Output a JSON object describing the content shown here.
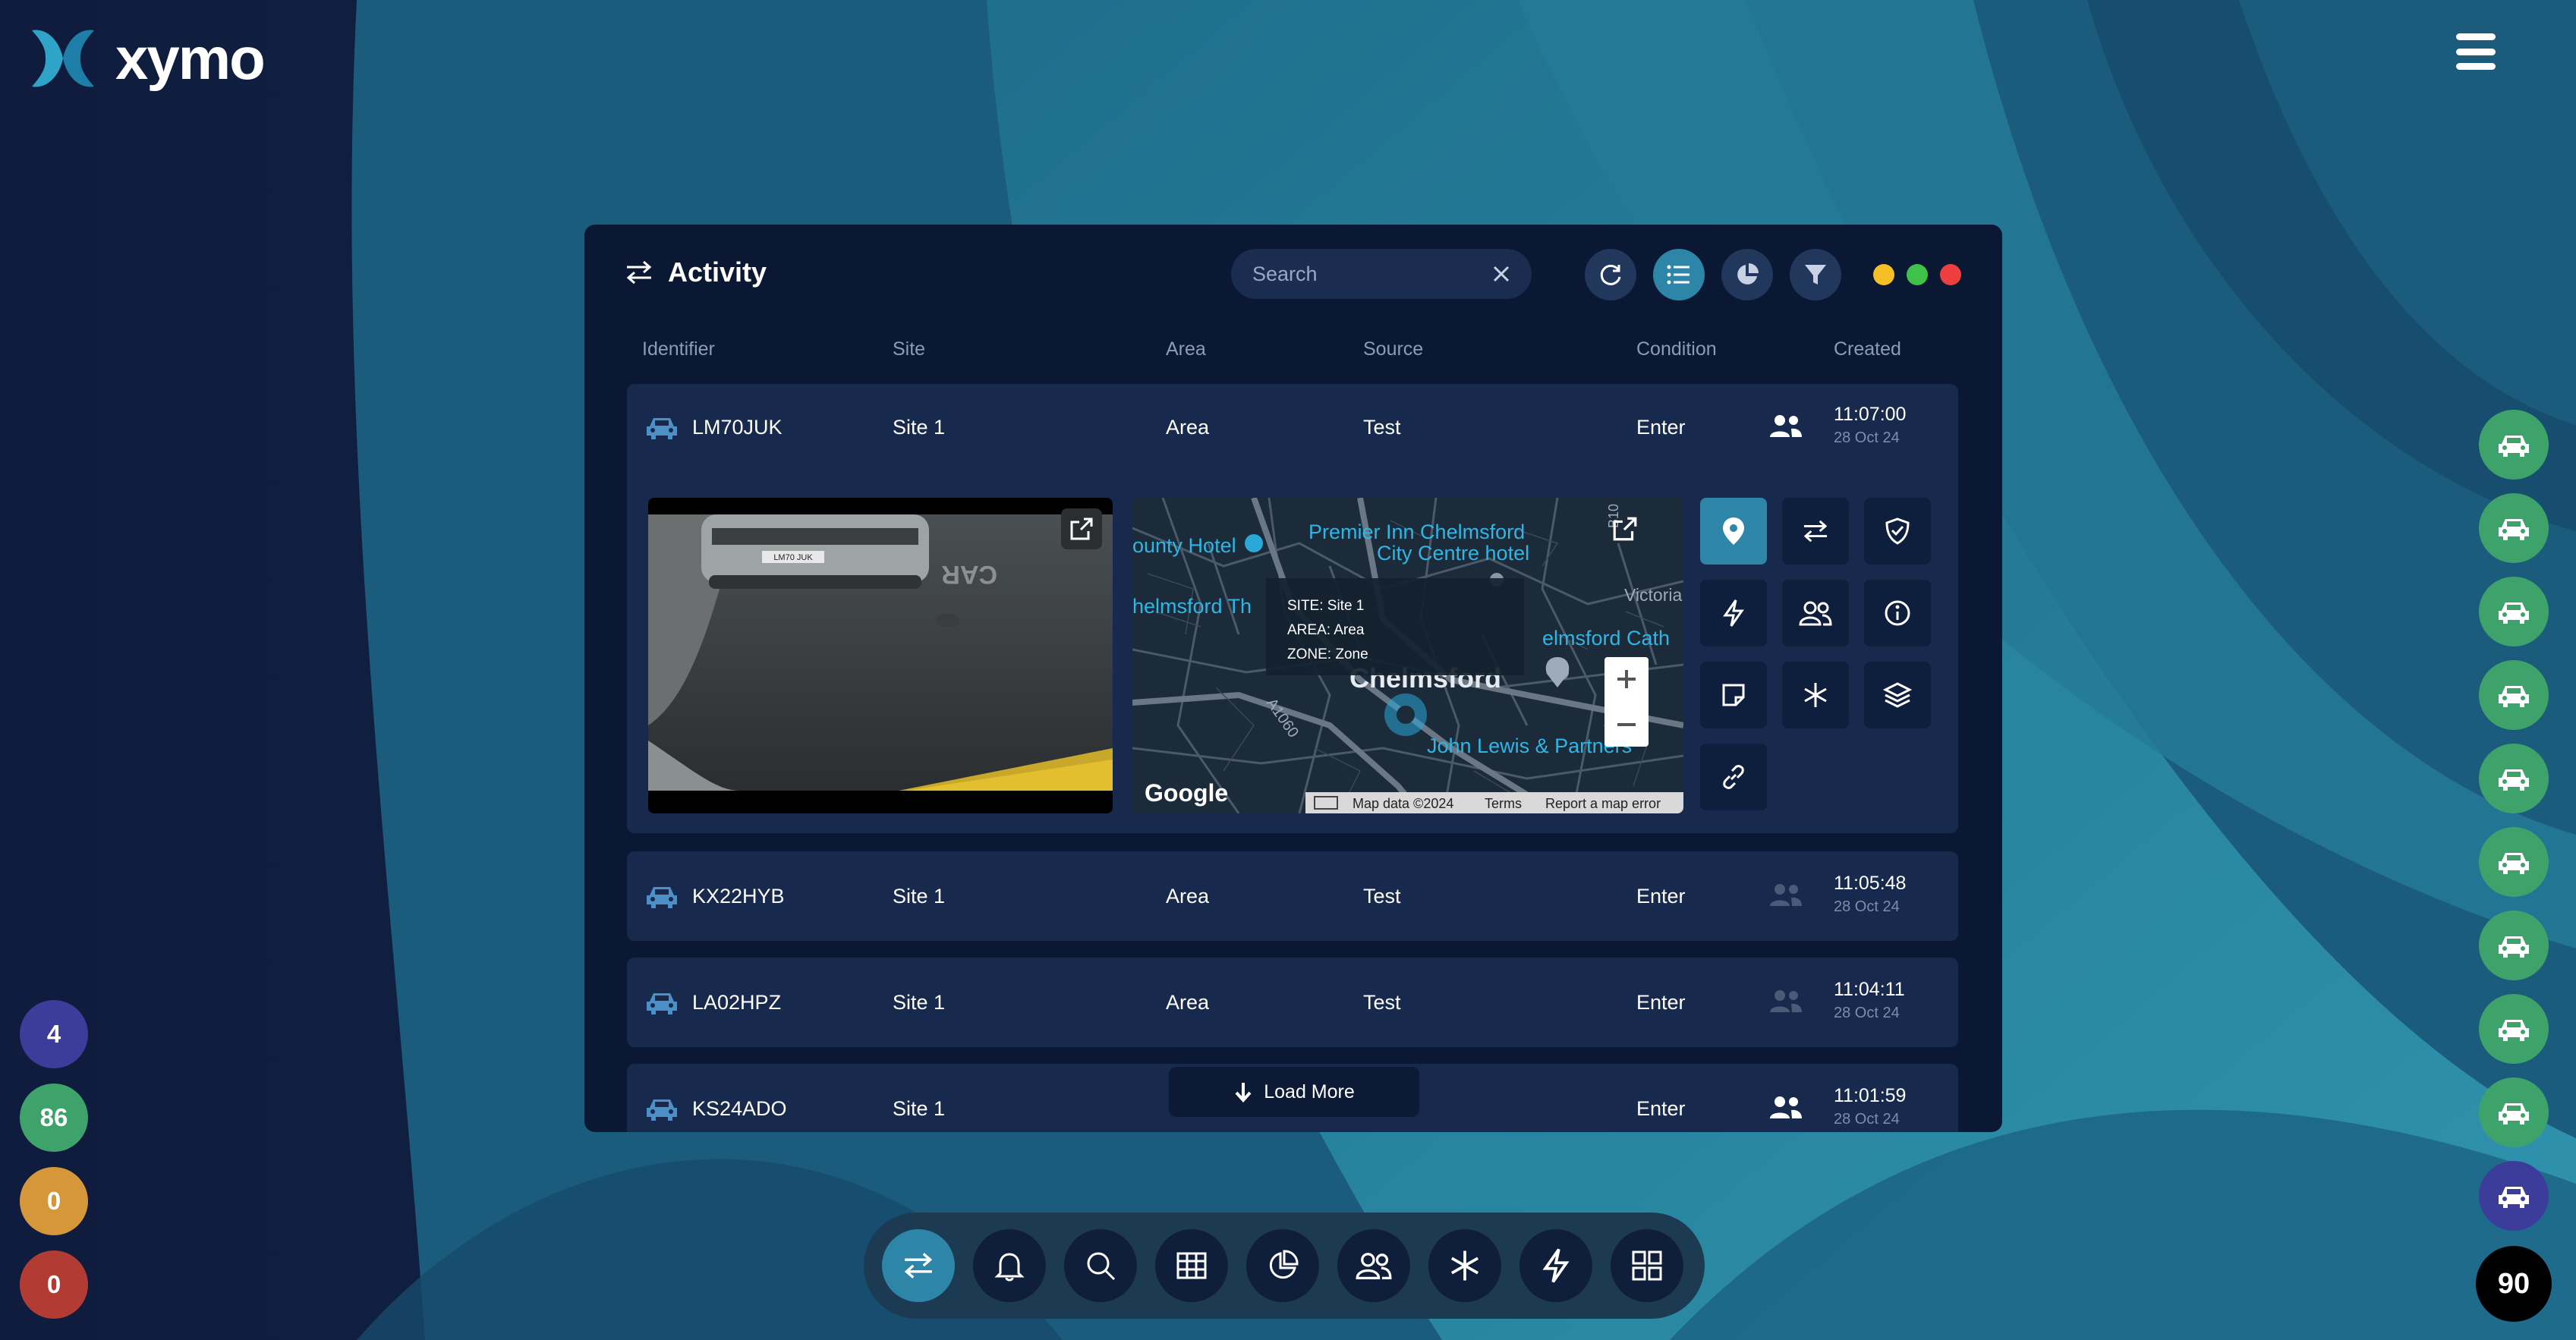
{
  "brand": {
    "name": "xymo"
  },
  "left_stats": [
    {
      "value": "4",
      "color": "#3c3c9a"
    },
    {
      "value": "86",
      "color": "#3ea36a"
    },
    {
      "value": "0",
      "color": "#d6973a"
    },
    {
      "value": "0",
      "color": "#b23b34"
    }
  ],
  "right_count": "90",
  "panel": {
    "title": "Activity",
    "search_placeholder": "Search",
    "window_dots": [
      "#f5c026",
      "#3ec24a",
      "#ee3f3f"
    ]
  },
  "columns": [
    "Identifier",
    "Site",
    "Area",
    "Source",
    "Condition",
    "Created"
  ],
  "rows": [
    {
      "identifier": "LM70JUK",
      "site": "Site 1",
      "area": "Area",
      "source": "Test",
      "condition": "Enter",
      "time": "11:07:00",
      "date": "28 Oct 24",
      "people_active": true
    },
    {
      "identifier": "KX22HYB",
      "site": "Site 1",
      "area": "Area",
      "source": "Test",
      "condition": "Enter",
      "time": "11:05:48",
      "date": "28 Oct 24",
      "people_active": false
    },
    {
      "identifier": "LA02HPZ",
      "site": "Site 1",
      "area": "Area",
      "source": "Test",
      "condition": "Enter",
      "time": "11:04:11",
      "date": "28 Oct 24",
      "people_active": false
    },
    {
      "identifier": "KS24ADO",
      "site": "Site 1",
      "area": "",
      "source": "",
      "condition": "Enter",
      "time": "11:01:59",
      "date": "28 Oct 24",
      "people_active": true
    }
  ],
  "photo": {
    "plate_text": "LM70 JUK",
    "road_text": "CAR"
  },
  "map": {
    "labels": {
      "poi1": "Premier Inn Chelmsford",
      "poi1b": "City Centre hotel",
      "poi2": "ounty Hotel",
      "poi3": "helmsford Th",
      "poi4": "Victoria",
      "poi5": "elmsford Cath",
      "poi6": "John Lewis & Partners",
      "road1": "A1060",
      "road2": "B10",
      "town": "Chelmsford"
    },
    "info": {
      "site": "SITE: Site 1",
      "area": "AREA: Area",
      "zone": "ZONE: Zone"
    },
    "google": "Google",
    "attribution": [
      "Map data ©2024",
      "Terms",
      "Report a map error"
    ]
  },
  "load_more": "Load More",
  "actions": [
    "location-pin-icon",
    "swap-arrows-icon",
    "shield-check-icon",
    "lightning-icon",
    "people-icon",
    "info-icon",
    "note-icon",
    "asterisk-icon",
    "layers-icon",
    "link-icon"
  ],
  "dock": [
    "swap-arrows-icon",
    "bell-icon",
    "search-icon",
    "grid-table-icon",
    "pie-chart-icon",
    "people-icon",
    "asterisk-icon",
    "lightning-icon",
    "dashboard-icon"
  ]
}
